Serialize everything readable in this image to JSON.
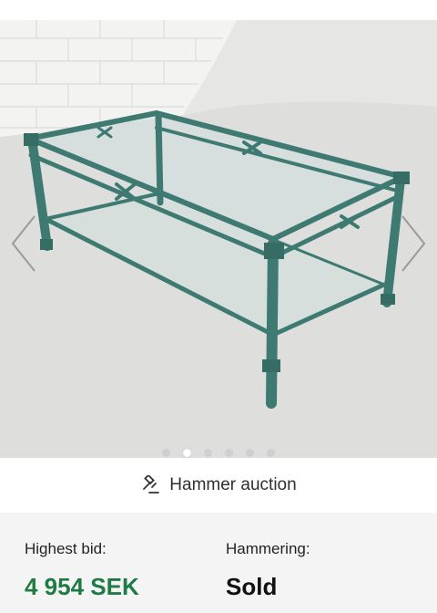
{
  "gallery": {
    "image_alt": "Green metal coffee table with glass tops",
    "slide_count": 6,
    "active_index": 1
  },
  "auction": {
    "type_label": "Hammer auction",
    "type_icon": "gavel-icon"
  },
  "bid": {
    "highest_label": "Highest bid:",
    "highest_value": "4 954 SEK",
    "status_label": "Hammering:",
    "status_value": "Sold"
  },
  "colors": {
    "bid_value": "#1f7a44",
    "panel_bg": "#f4f4f5"
  }
}
